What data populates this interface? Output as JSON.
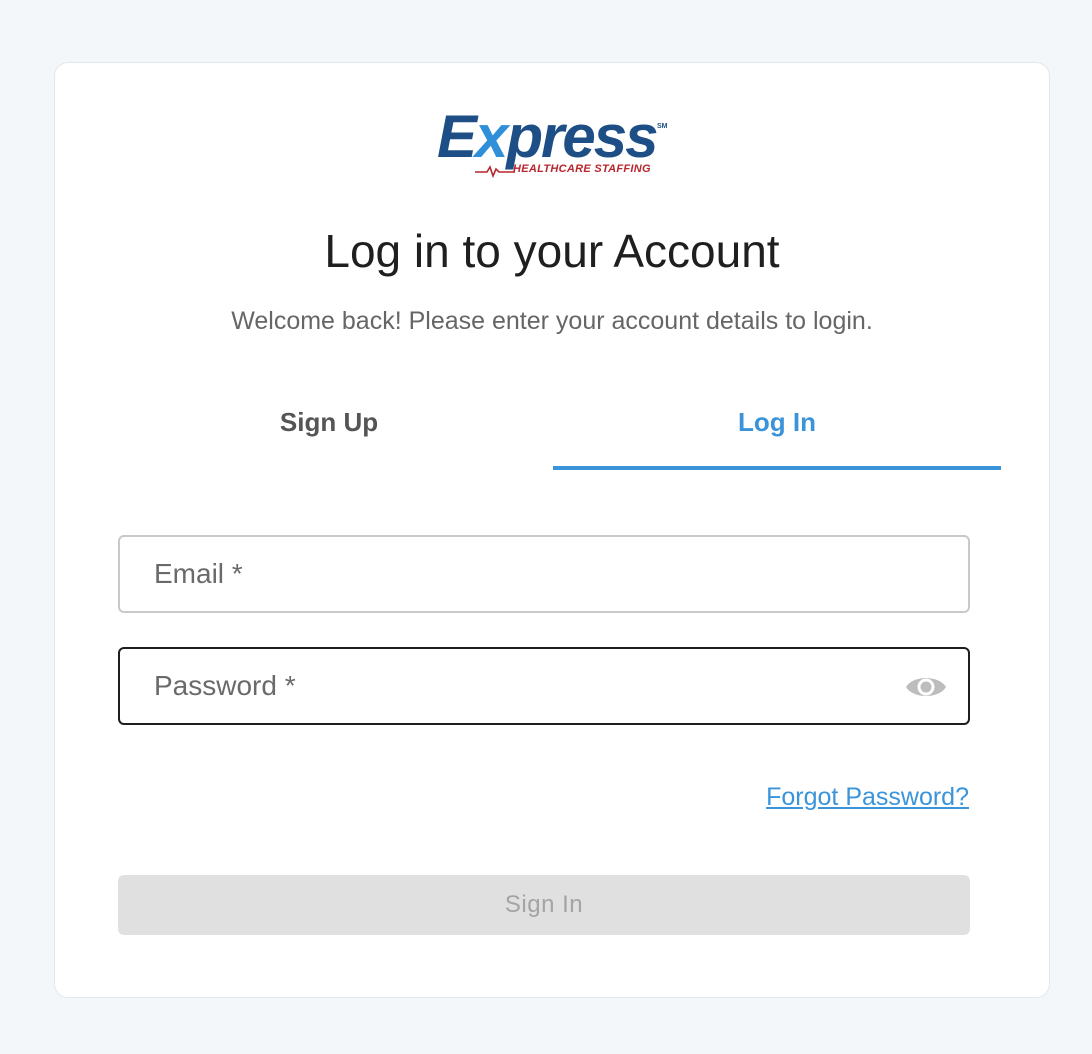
{
  "brand": {
    "name_main": "E",
    "name_x": "x",
    "name_rest": "press",
    "service_mark": "SM",
    "tagline": "HEALTHCARE STAFFING",
    "colors": {
      "navy": "#1d4f86",
      "blue": "#2f8fd8",
      "red": "#b7262c"
    }
  },
  "header": {
    "title": "Log in to your Account",
    "subtitle": "Welcome back! Please enter your account details to login."
  },
  "tabs": [
    {
      "label": "Sign Up",
      "active": false
    },
    {
      "label": "Log In",
      "active": true
    }
  ],
  "form": {
    "email": {
      "value": "",
      "placeholder": "Email *"
    },
    "password": {
      "value": "",
      "placeholder": "Password *",
      "icon": "eye-icon"
    },
    "forgot_label": "Forgot Password?",
    "submit_label": "Sign In",
    "submit_enabled": false
  },
  "theme": {
    "accent": "#3b94d9",
    "page_background": "#f3f7f9",
    "disabled_button": "#e0e0e0"
  }
}
